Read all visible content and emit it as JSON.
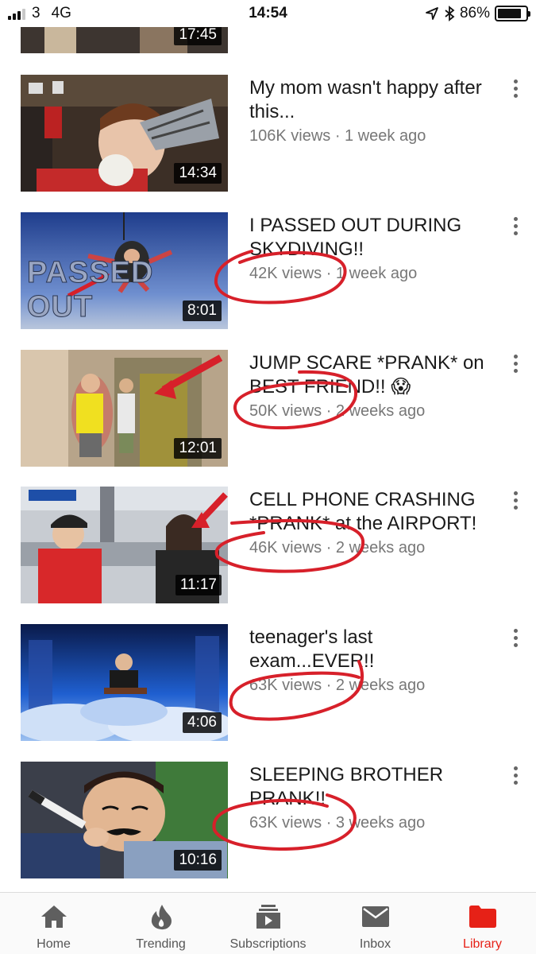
{
  "status_bar": {
    "carrier": "3",
    "network": "4G",
    "time": "14:54",
    "battery": "86%",
    "battery_level": 0.86
  },
  "videos": [
    {
      "title": "",
      "meta": "",
      "duration": "17:45"
    },
    {
      "title": "My mom wasn't happy after this...",
      "meta": "106K views · 1 week ago",
      "duration": "14:34"
    },
    {
      "title": "I PASSED OUT DURING SKYDIVING!!",
      "meta": "42K views · 1 week ago",
      "duration": "8:01",
      "overlay": "PASSED OUT"
    },
    {
      "title": "JUMP SCARE *PRANK* on BEST FRIEND!! 😱",
      "meta": "50K views · 2 weeks ago",
      "duration": "12:01"
    },
    {
      "title": "CELL PHONE CRASHING *PRANK* at the AIRPORT!",
      "meta": "46K views · 2 weeks ago",
      "duration": "11:17"
    },
    {
      "title": "teenager's last exam...EVER!!",
      "meta": "63K views · 2 weeks ago",
      "duration": "4:06"
    },
    {
      "title": "SLEEPING BROTHER PRANK!!",
      "meta": "63K views · 3 weeks ago",
      "duration": "10:16"
    }
  ],
  "bottom_nav": [
    {
      "label": "Home",
      "icon": "home-icon"
    },
    {
      "label": "Trending",
      "icon": "flame-icon"
    },
    {
      "label": "Subscriptions",
      "icon": "subscriptions-icon"
    },
    {
      "label": "Inbox",
      "icon": "envelope-icon"
    },
    {
      "label": "Library",
      "icon": "folder-icon",
      "active": true
    }
  ],
  "colors": {
    "accent": "#e62117",
    "scribble": "#d7202a",
    "meta_text": "#777777"
  }
}
